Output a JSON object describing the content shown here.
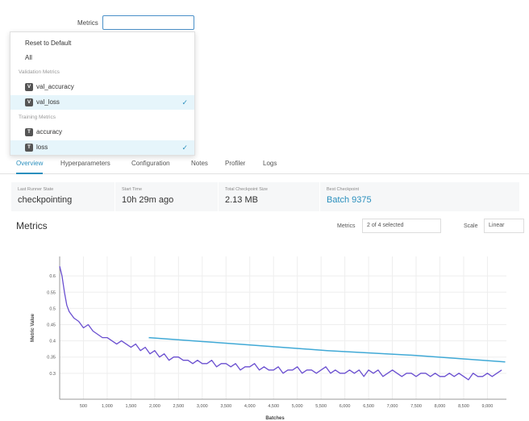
{
  "metrics_field": {
    "label": "Metrics",
    "value": ""
  },
  "dropdown": {
    "reset": "Reset to Default",
    "all": "All",
    "validation_group": "Validation Metrics",
    "training_group": "Training Metrics",
    "items": [
      {
        "chip": "V",
        "label": "val_accuracy",
        "selected": false
      },
      {
        "chip": "V",
        "label": "val_loss",
        "selected": true
      },
      {
        "chip": "T",
        "label": "accuracy",
        "selected": false
      },
      {
        "chip": "T",
        "label": "loss",
        "selected": true
      }
    ],
    "check": "✓"
  },
  "tabs": [
    "Overview",
    "Hyperparameters",
    "Configuration",
    "Notes",
    "Profiler",
    "Logs"
  ],
  "active_tab": "Overview",
  "stats": [
    {
      "caption": "Last Runner State",
      "value": "checkpointing"
    },
    {
      "caption": "Start Time",
      "value": "10h 29m ago"
    },
    {
      "caption": "Total Checkpoint Size",
      "value": "2.13 MB"
    },
    {
      "caption": "Best Checkpoint",
      "value": "Batch 9375"
    }
  ],
  "metrics_section": {
    "title": "Metrics",
    "metrics_label": "Metrics",
    "metrics_selected": "2 of 4 selected",
    "scale_label": "Scale",
    "scale_value": "Linear"
  },
  "colors": {
    "accent": "#2a8fbd",
    "loss_line": "#6a4fd0",
    "val_loss_line": "#40a9d6"
  },
  "chart_data": {
    "type": "line",
    "xlabel": "Batches",
    "ylabel": "Metric Value",
    "xlim": [
      0,
      9400
    ],
    "ylim": [
      0.22,
      0.66
    ],
    "x_ticks": [
      500,
      1000,
      1500,
      2000,
      2500,
      3000,
      3500,
      4000,
      4500,
      5000,
      5500,
      6000,
      6500,
      7000,
      7500,
      8000,
      8500,
      9000
    ],
    "x_tick_labels": [
      "500",
      "1,000",
      "1,500",
      "2,000",
      "2,500",
      "3,000",
      "3,500",
      "4,000",
      "4,500",
      "5,000",
      "5,500",
      "6,000",
      "6,500",
      "7,000",
      "7,500",
      "8,000",
      "8,500",
      "9,000"
    ],
    "y_ticks": [
      0.3,
      0.35,
      0.4,
      0.45,
      0.5,
      0.55,
      0.6
    ],
    "y_tick_labels": [
      "0.3",
      "0.35",
      "0.4",
      "0.45",
      "0.5",
      "0.55",
      "0.6"
    ],
    "series": [
      {
        "name": "loss",
        "x": [
          0,
          50,
          100,
          150,
          200,
          300,
          400,
          500,
          600,
          700,
          800,
          900,
          1000,
          1100,
          1200,
          1300,
          1400,
          1500,
          1600,
          1700,
          1800,
          1900,
          2000,
          2100,
          2200,
          2300,
          2400,
          2500,
          2600,
          2700,
          2800,
          2900,
          3000,
          3100,
          3200,
          3300,
          3400,
          3500,
          3600,
          3700,
          3800,
          3900,
          4000,
          4100,
          4200,
          4300,
          4400,
          4500,
          4600,
          4700,
          4800,
          4900,
          5000,
          5100,
          5200,
          5300,
          5400,
          5500,
          5600,
          5700,
          5800,
          5900,
          6000,
          6100,
          6200,
          6300,
          6400,
          6500,
          6600,
          6700,
          6800,
          6900,
          7000,
          7100,
          7200,
          7300,
          7400,
          7500,
          7600,
          7700,
          7800,
          7900,
          8000,
          8100,
          8200,
          8300,
          8400,
          8500,
          8600,
          8700,
          8800,
          8900,
          9000,
          9100,
          9200,
          9300
        ],
        "values": [
          0.63,
          0.6,
          0.55,
          0.51,
          0.49,
          0.47,
          0.46,
          0.44,
          0.45,
          0.43,
          0.42,
          0.41,
          0.41,
          0.4,
          0.39,
          0.4,
          0.39,
          0.38,
          0.39,
          0.37,
          0.38,
          0.36,
          0.37,
          0.35,
          0.36,
          0.34,
          0.35,
          0.35,
          0.34,
          0.34,
          0.33,
          0.34,
          0.33,
          0.33,
          0.34,
          0.32,
          0.33,
          0.33,
          0.32,
          0.33,
          0.31,
          0.32,
          0.32,
          0.33,
          0.31,
          0.32,
          0.31,
          0.31,
          0.32,
          0.3,
          0.31,
          0.31,
          0.32,
          0.3,
          0.31,
          0.31,
          0.3,
          0.31,
          0.32,
          0.3,
          0.31,
          0.3,
          0.3,
          0.31,
          0.3,
          0.31,
          0.29,
          0.31,
          0.3,
          0.31,
          0.29,
          0.3,
          0.31,
          0.3,
          0.29,
          0.3,
          0.3,
          0.29,
          0.3,
          0.3,
          0.29,
          0.3,
          0.29,
          0.29,
          0.3,
          0.29,
          0.3,
          0.29,
          0.28,
          0.3,
          0.29,
          0.29,
          0.3,
          0.29,
          0.3,
          0.31
        ]
      },
      {
        "name": "val_loss",
        "x": [
          1875,
          3750,
          5625,
          7500,
          9375
        ],
        "values": [
          0.41,
          0.39,
          0.37,
          0.355,
          0.335
        ]
      }
    ]
  }
}
